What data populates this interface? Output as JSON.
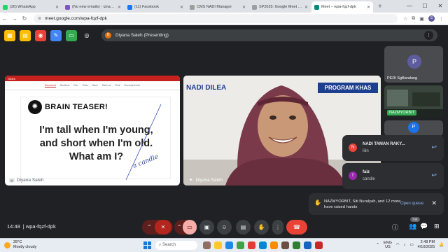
{
  "browser": {
    "tabs": [
      {
        "title": "(26) WhatsApp",
        "color": "#25d366"
      },
      {
        "title": "(No new emails) - iznahu...",
        "color": "#7e57c2"
      },
      {
        "title": "(11) Facebook",
        "color": "#1877f2"
      },
      {
        "title": "CMS NADI Manager",
        "color": "#9e9e9e"
      },
      {
        "title": "SP2025: Google Meet Ro...",
        "color": "#9e9e9e"
      },
      {
        "title": "Meet – wpa-fqzf-dpk",
        "color": "#00897b"
      }
    ],
    "new_tab": "+",
    "url": "meet.google.com/wpa-fqzf-dpk",
    "profile_initial": "S"
  },
  "meet": {
    "presenter_initial": "D",
    "presenting_label": "Diyana Saleh (Presenting)",
    "slide": {
      "app_label": "Slides",
      "toolbar_tabs": [
        "Document",
        "Sections",
        "Pen",
        "Tools"
      ],
      "toolbar_actions": [
        "Save",
        "Save as",
        "Print",
        "Document info"
      ],
      "heading": "BRAIN TEASER!",
      "riddle_lines": [
        "I'm tall when I'm young,",
        "and short when I'm old.",
        "What am I?"
      ],
      "handwriting": "a candle",
      "owner_name": "Diyana Saleh"
    },
    "camera": {
      "banner_left": "NADI DILEA",
      "banner_right": "PROGRAM KHAS",
      "name": "Diyana Saleh"
    },
    "participants": [
      {
        "initial": "P",
        "name": "PEDI SgBandung",
        "color": "#5e5c9e"
      },
      {
        "name": "NAZMYORBIT"
      },
      {
        "initial": "P",
        "name": "",
        "color": "#1a73e8"
      }
    ],
    "chat": [
      {
        "initial": "N",
        "sender": "NADI TAMAN RAKY...",
        "message": "lilin",
        "color": "#e8453c"
      },
      {
        "initial": "f",
        "sender": "faiz",
        "message": "candle",
        "color": "#9c27b0"
      }
    ],
    "raised_hands": {
      "text": "NAZMYORBIT, Siti Nuralyah, and 12 more have raised hands",
      "action": "Open queue"
    },
    "time": "14:48",
    "meeting_code": "wpa-fqzf-dpk",
    "participant_count": "745"
  },
  "taskbar": {
    "temperature": "28°C",
    "weather": "Mostly cloudy",
    "search_placeholder": "Search",
    "lang_1": "ENG",
    "lang_2": "US",
    "clock_time": "2:48 PM",
    "clock_date": "4/10/2025"
  }
}
